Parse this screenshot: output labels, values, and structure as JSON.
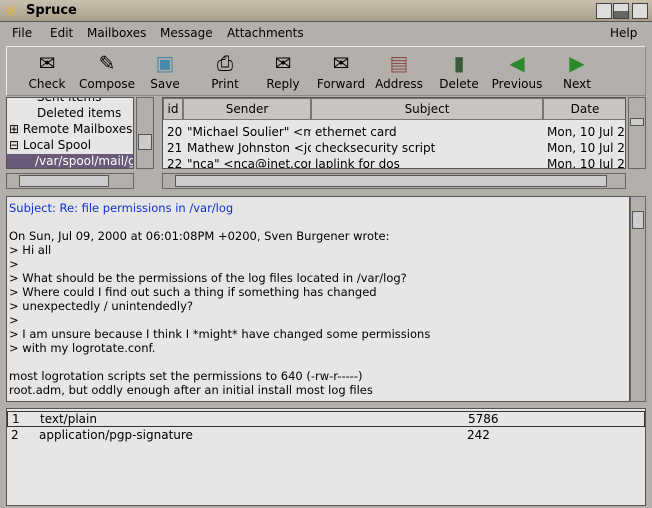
{
  "window": {
    "title": "Spruce"
  },
  "menu": [
    "File",
    "Edit",
    "Mailboxes",
    "Message",
    "Attachments"
  ],
  "menu_help": "Help",
  "toolbar": [
    {
      "label": "Check",
      "icon": "mail-check-icon"
    },
    {
      "label": "Compose",
      "icon": "compose-icon"
    },
    {
      "label": "Save",
      "icon": "save-icon"
    },
    {
      "label": "Print",
      "icon": "printer-icon"
    },
    {
      "label": "Reply",
      "icon": "reply-icon"
    },
    {
      "label": "Forward",
      "icon": "forward-icon"
    },
    {
      "label": "Address",
      "icon": "address-book-icon"
    },
    {
      "label": "Delete",
      "icon": "trash-icon"
    },
    {
      "label": "Previous",
      "icon": "arrow-left-icon"
    },
    {
      "label": "Next",
      "icon": "arrow-right-icon"
    }
  ],
  "tree": {
    "items": [
      "Sent items",
      "Deleted items",
      "Remote Mailboxes",
      "Local Spool",
      "/var/spool/mail/gi"
    ],
    "selected": 4
  },
  "messages": {
    "columns": [
      "id",
      "Sender",
      "Subject",
      "Date"
    ],
    "rows": [
      {
        "id": "20",
        "sender": "\"Michael Soulier\" <m:",
        "subject": "ethernet card",
        "date": "Mon, 10 Jul 2"
      },
      {
        "id": "21",
        "sender": "Mathew Johnston <jo",
        "subject": "checksecurity script",
        "date": "Mon, 10 Jul 2"
      },
      {
        "id": "22",
        "sender": "\"nca\" <nca@inet.com",
        "subject": "laplink for dos",
        "date": "Mon, 10 Jul 2"
      }
    ]
  },
  "preview": {
    "subject": "Subject: Re: file permissions in /var/log",
    "body": "\nOn Sun, Jul 09, 2000 at 06:01:08PM +0200, Sven Burgener wrote:\n> Hi all\n>\n> What should be the permissions of the log files located in /var/log?\n> Where could I find out such a thing if something has changed\n> unexpectedly / unintendedly?\n>\n> I am unsure because I think I *might* have changed some permissions\n> with my logrotate.conf.\n\nmost logrotation scripts set the permissions to 640 (-rw-r-----)\nroot.adm, but oddly enough after an initial install most log files"
  },
  "attachments": [
    {
      "num": "1",
      "type": "text/plain",
      "size": "5786"
    },
    {
      "num": "2",
      "type": "application/pgp-signature",
      "size": "242"
    }
  ]
}
